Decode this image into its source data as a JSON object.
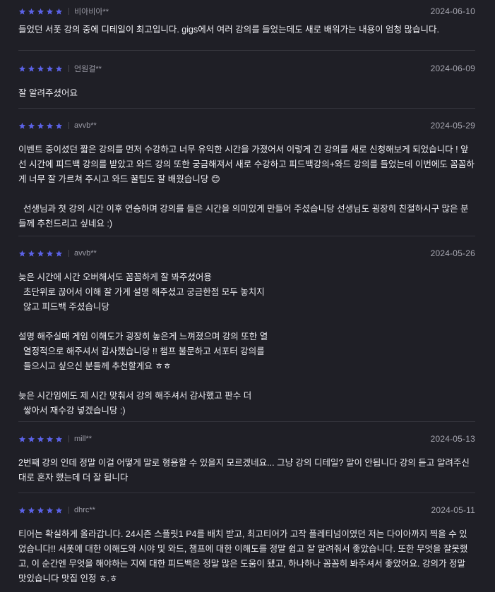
{
  "reviews": [
    {
      "rating": 5,
      "author": "비아비아**",
      "date": "2024-06-10",
      "text": "들었던 서폿 강의 중에 디테일이 최고입니다. gigs에서 여러 강의를 들었는데도 새로 배워가는 내용이 엄청 많습니다."
    },
    {
      "rating": 5,
      "author": "언원걸**",
      "date": "2024-06-09",
      "text": "잘 알려주셨어요"
    },
    {
      "rating": 5,
      "author": "avvb**",
      "date": "2024-05-29",
      "text": "이벤트 중이셨던 짧은 강의를 먼저 수강하고 너무 유익한 시간을 가졌어서 이렇게 긴 강의를 새로 신청해보게 되었습니다 ! 앞선 시간에 피드백 강의를 받았고 와드 강의 또한 궁금해져서 새로 수강하고 피드백강의+와드 강의를 들었는데 이번에도 꼼꼼하게 너무 잘 가르쳐 주시고 와드 꿀팁도 잘 배웠습니당 😊\n\n  선생님과 첫 강의 시간 이후 연승하며 강의를 들은 시간을 의미있게 만들어 주셨습니당 선생님도 굉장히 친절하시구 많은 분들께 추천드리고 싶네요 :)"
    },
    {
      "rating": 5,
      "author": "avvb**",
      "date": "2024-05-26",
      "text": "늦은 시간에 시간 오버해서도 꼼꼼하게 잘 봐주셨어용\n  초단위로 끊어서 이해 잘 가게 설명 해주셨고 궁금한점 모두 놓치지\n  않고 피드백 주셨습니당\n\n설명 해주실때 게임 이해도가 굉장히 높은게 느껴졌으며 강의 또한 열\n  열정적으로 해주셔서 감사했습니당 !! 챔프 불문하고 서포터 강의를\n  들으시고 싶으신 분들께 추천할게요 ㅎㅎ\n\n늦은 시간임에도 제 시간 맞춰서 강의 해주셔서 감사했고 판수 더\n  쌓아서 재수강 넣겠습니당 :)"
    },
    {
      "rating": 5,
      "author": "mill**",
      "date": "2024-05-13",
      "text": "2번째 강의 인데 정말 이걸 어떻게 말로 형용할 수 있을지 모르겠네요... 그냥 강의 디테일? 말이 안됩니다 강의 듣고 알려주신 대로 혼자 했는데 더 잘 됩니다"
    },
    {
      "rating": 5,
      "author": "dhrc**",
      "date": "2024-05-11",
      "text": "티어는 확실하게 올라갑니다. 24시즌 스플릿1 P4를 배치 받고, 최고티어가 고작 플레티넘이였던 저는 다이아까지 찍을 수 있었습니다!! 서폿에 대한 이해도와 시야 및 와드, 챔프에 대한 이해도를 정말 쉽고 잘 알려줘서 좋았습니다. 또한 무엇을 잘못했고, 이 순간엔 무엇을 해야하는 지에 대한 피드백은 정말 많은 도움이 됐고, 하나하나 꼼꼼히 봐주셔서 좋았어요. 강의가 정말 맛있습니다 맛집 인정 ㅎ.ㅎ"
    }
  ],
  "colors": {
    "background": "#1f1f26",
    "star": "#5b62e6",
    "divider": "#34343c",
    "text": "#ececf1",
    "muted": "#9d9da8"
  },
  "icons": {
    "rating": "star-icon"
  }
}
